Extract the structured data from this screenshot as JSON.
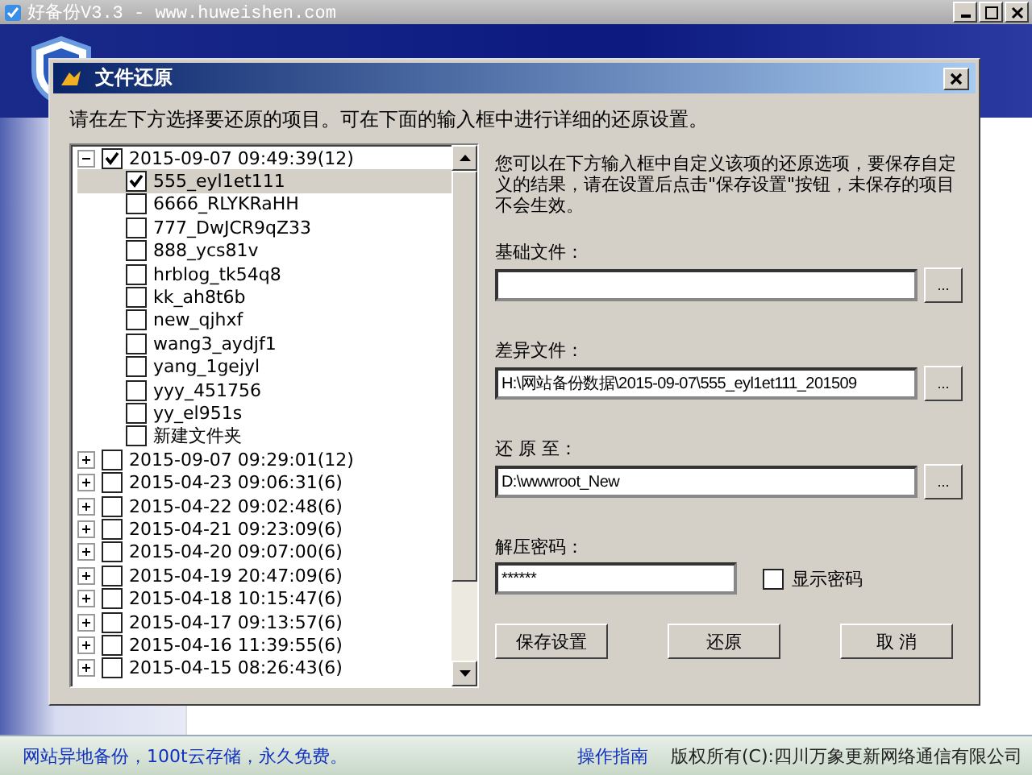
{
  "window": {
    "title": "好备份V3.3 - www.huweishen.com"
  },
  "dialog": {
    "title": "文件还原",
    "instruction": "请在左下方选择要还原的项目。可在下面的输入框中进行详细的还原设置。",
    "tree": [
      {
        "label": "2015-09-07 09:49:39(12)",
        "checked": true,
        "expanded": true,
        "selected": false,
        "children": [
          {
            "label": "555_eyl1et111",
            "checked": true,
            "selected": true
          },
          {
            "label": "6666_RLYKRaHH",
            "checked": false,
            "selected": false
          },
          {
            "label": "777_DwJCR9qZ33",
            "checked": false,
            "selected": false
          },
          {
            "label": "888_ycs81v",
            "checked": false,
            "selected": false
          },
          {
            "label": "hrblog_tk54q8",
            "checked": false,
            "selected": false
          },
          {
            "label": "kk_ah8t6b",
            "checked": false,
            "selected": false
          },
          {
            "label": "new_qjhxf",
            "checked": false,
            "selected": false
          },
          {
            "label": "wang3_aydjf1",
            "checked": false,
            "selected": false
          },
          {
            "label": "yang_1gejyl",
            "checked": false,
            "selected": false
          },
          {
            "label": "yyy_451756",
            "checked": false,
            "selected": false
          },
          {
            "label": "yy_el951s",
            "checked": false,
            "selected": false
          },
          {
            "label": "新建文件夹",
            "checked": false,
            "selected": false
          }
        ]
      },
      {
        "label": "2015-09-07 09:29:01(12)",
        "checked": false,
        "expanded": false,
        "selected": false
      },
      {
        "label": "2015-04-23 09:06:31(6)",
        "checked": false,
        "expanded": false,
        "selected": false
      },
      {
        "label": "2015-04-22 09:02:48(6)",
        "checked": false,
        "expanded": false,
        "selected": false
      },
      {
        "label": "2015-04-21 09:23:09(6)",
        "checked": false,
        "expanded": false,
        "selected": false
      },
      {
        "label": "2015-04-20 09:07:00(6)",
        "checked": false,
        "expanded": false,
        "selected": false
      },
      {
        "label": "2015-04-19 20:47:09(6)",
        "checked": false,
        "expanded": false,
        "selected": false
      },
      {
        "label": "2015-04-18 10:15:47(6)",
        "checked": false,
        "expanded": false,
        "selected": false
      },
      {
        "label": "2015-04-17 09:13:57(6)",
        "checked": false,
        "expanded": false,
        "selected": false
      },
      {
        "label": "2015-04-16 11:39:55(6)",
        "checked": false,
        "expanded": false,
        "selected": false
      },
      {
        "label": "2015-04-15 08:26:43(6)",
        "checked": false,
        "expanded": false,
        "selected": false
      }
    ],
    "help_text": "您可以在下方输入框中自定义该项的还原选项，要保存自定义的结果，请在设置后点击\"保存设置\"按钮，未保存的项目不会生效。",
    "fields": [
      {
        "label": "基础文件：",
        "browse": "..."
      },
      {
        "label": "差异文件：",
        "value": "H:\\网站备份数据\\2015-09-07\\555_eyl1et111_201509",
        "browse": "..."
      },
      {
        "label": "还 原 至：",
        "value": "D:\\wwwroot_New",
        "browse": "..."
      }
    ],
    "password": {
      "label": "解压密码：",
      "value": "******"
    },
    "show_password": {
      "label": "显示密码",
      "checked": false
    },
    "buttons": [
      "保存设置",
      "还原",
      "取 消"
    ]
  },
  "status_bar": {
    "promo": "网站异地备份，100t云存储，永久免费。",
    "guide_link": "操作指南",
    "copyright": "版权所有(C):四川万象更新网络通信有限公司"
  }
}
